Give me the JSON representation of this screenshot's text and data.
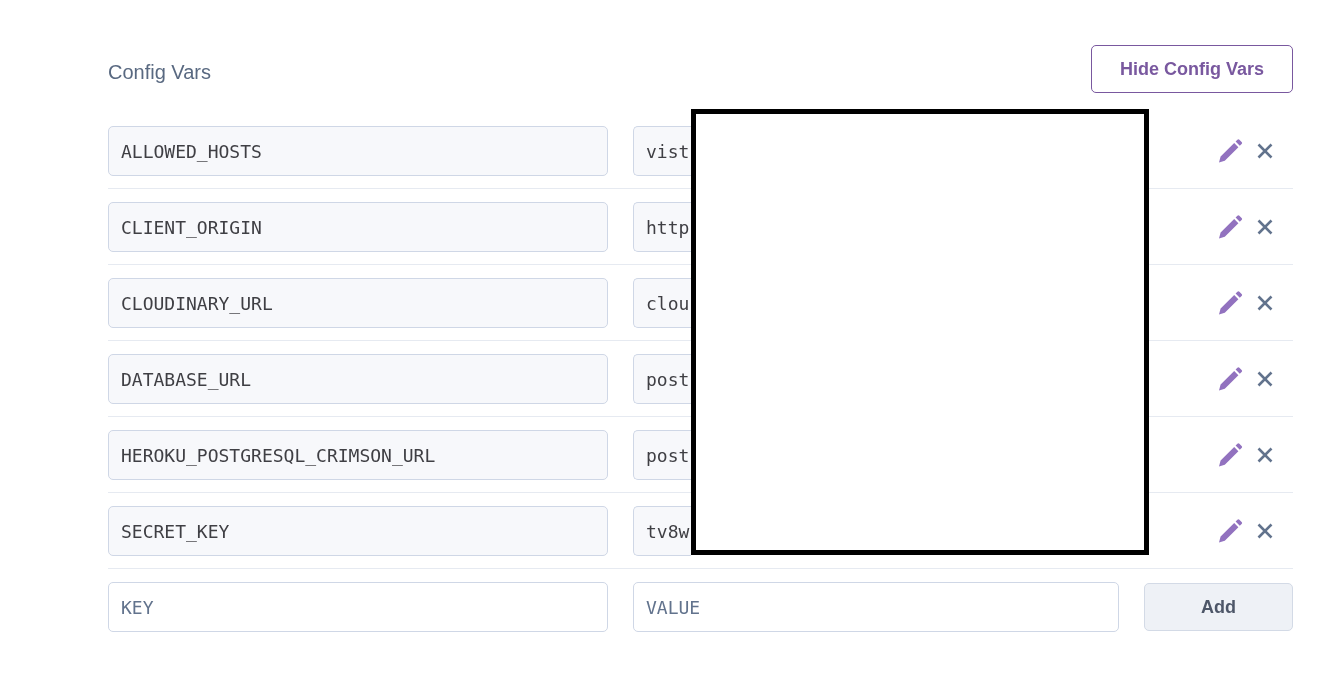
{
  "section": {
    "title": "Config Vars",
    "toggle_button": "Hide Config Vars"
  },
  "config_vars": [
    {
      "key": "ALLOWED_HOSTS",
      "value": "vist"
    },
    {
      "key": "CLIENT_ORIGIN",
      "value": "http"
    },
    {
      "key": "CLOUDINARY_URL",
      "value": "clou"
    },
    {
      "key": "DATABASE_URL",
      "value": "post"
    },
    {
      "key": "HEROKU_POSTGRESQL_CRIMSON_URL",
      "value": "post"
    },
    {
      "key": "SECRET_KEY",
      "value": "tv8w"
    }
  ],
  "new_var": {
    "key_placeholder": "KEY",
    "value_placeholder": "VALUE",
    "button": "Add"
  }
}
